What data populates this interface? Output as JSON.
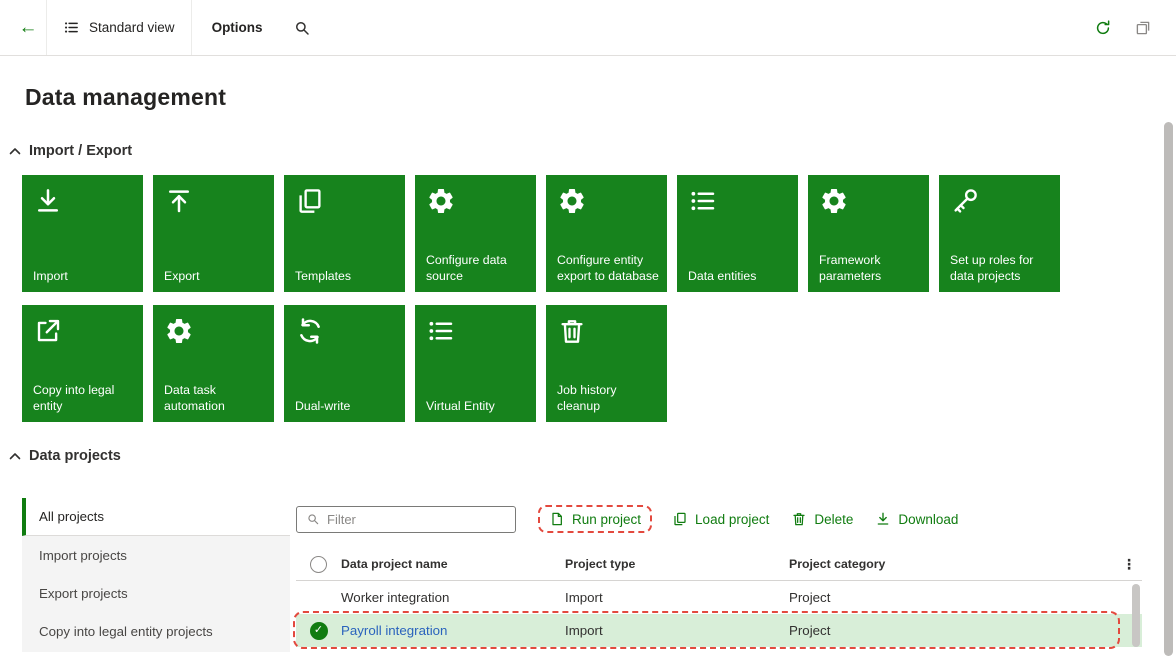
{
  "topbar": {
    "back_icon": "←",
    "view_label": "Standard view",
    "options_label": "Options"
  },
  "page_title": "Data management",
  "import_export": {
    "title": "Import / Export",
    "tiles": [
      {
        "label": "Import",
        "icon": "import-arrow-icon"
      },
      {
        "label": "Export",
        "icon": "export-arrow-icon"
      },
      {
        "label": "Templates",
        "icon": "copy-pages-icon"
      },
      {
        "label": "Configure data source",
        "icon": "gear-icon"
      },
      {
        "label": "Configure entity export to database",
        "icon": "gear-icon"
      },
      {
        "label": "Data entities",
        "icon": "list-icon"
      },
      {
        "label": "Framework parameters",
        "icon": "gear-icon"
      },
      {
        "label": "Set up roles for data projects",
        "icon": "key-icon"
      },
      {
        "label": "Copy into legal entity",
        "icon": "share-arrow-icon"
      },
      {
        "label": "Data task automation",
        "icon": "gear-icon"
      },
      {
        "label": "Dual-write",
        "icon": "sync-icon"
      },
      {
        "label": "Virtual Entity",
        "icon": "list-icon"
      },
      {
        "label": "Job history cleanup",
        "icon": "trash-icon"
      }
    ]
  },
  "data_projects": {
    "title": "Data projects",
    "nav_items": [
      "All projects",
      "Import projects",
      "Export projects",
      "Copy into legal entity projects"
    ],
    "selected_nav_item": "All projects",
    "filter_placeholder": "Filter",
    "actions": {
      "run": "Run project",
      "load": "Load project",
      "delete": "Delete",
      "download": "Download"
    },
    "table": {
      "columns": {
        "name": "Data project name",
        "type": "Project type",
        "category": "Project category"
      },
      "more_icon": "⋮",
      "rows": [
        {
          "name": "Worker integration",
          "type": "Import",
          "category": "Project",
          "selected": false
        },
        {
          "name": "Payroll integration",
          "type": "Import",
          "category": "Project",
          "selected": true
        }
      ]
    }
  },
  "icons": {
    "check": "✓"
  },
  "colors": {
    "accent_green": "#107c10",
    "tile_green": "#17831d",
    "selected_row_bg": "#d8eed8",
    "link_blue": "#2a63bd",
    "annotation_red": "#e3493e",
    "topbar_border": "#e1dfdd"
  }
}
